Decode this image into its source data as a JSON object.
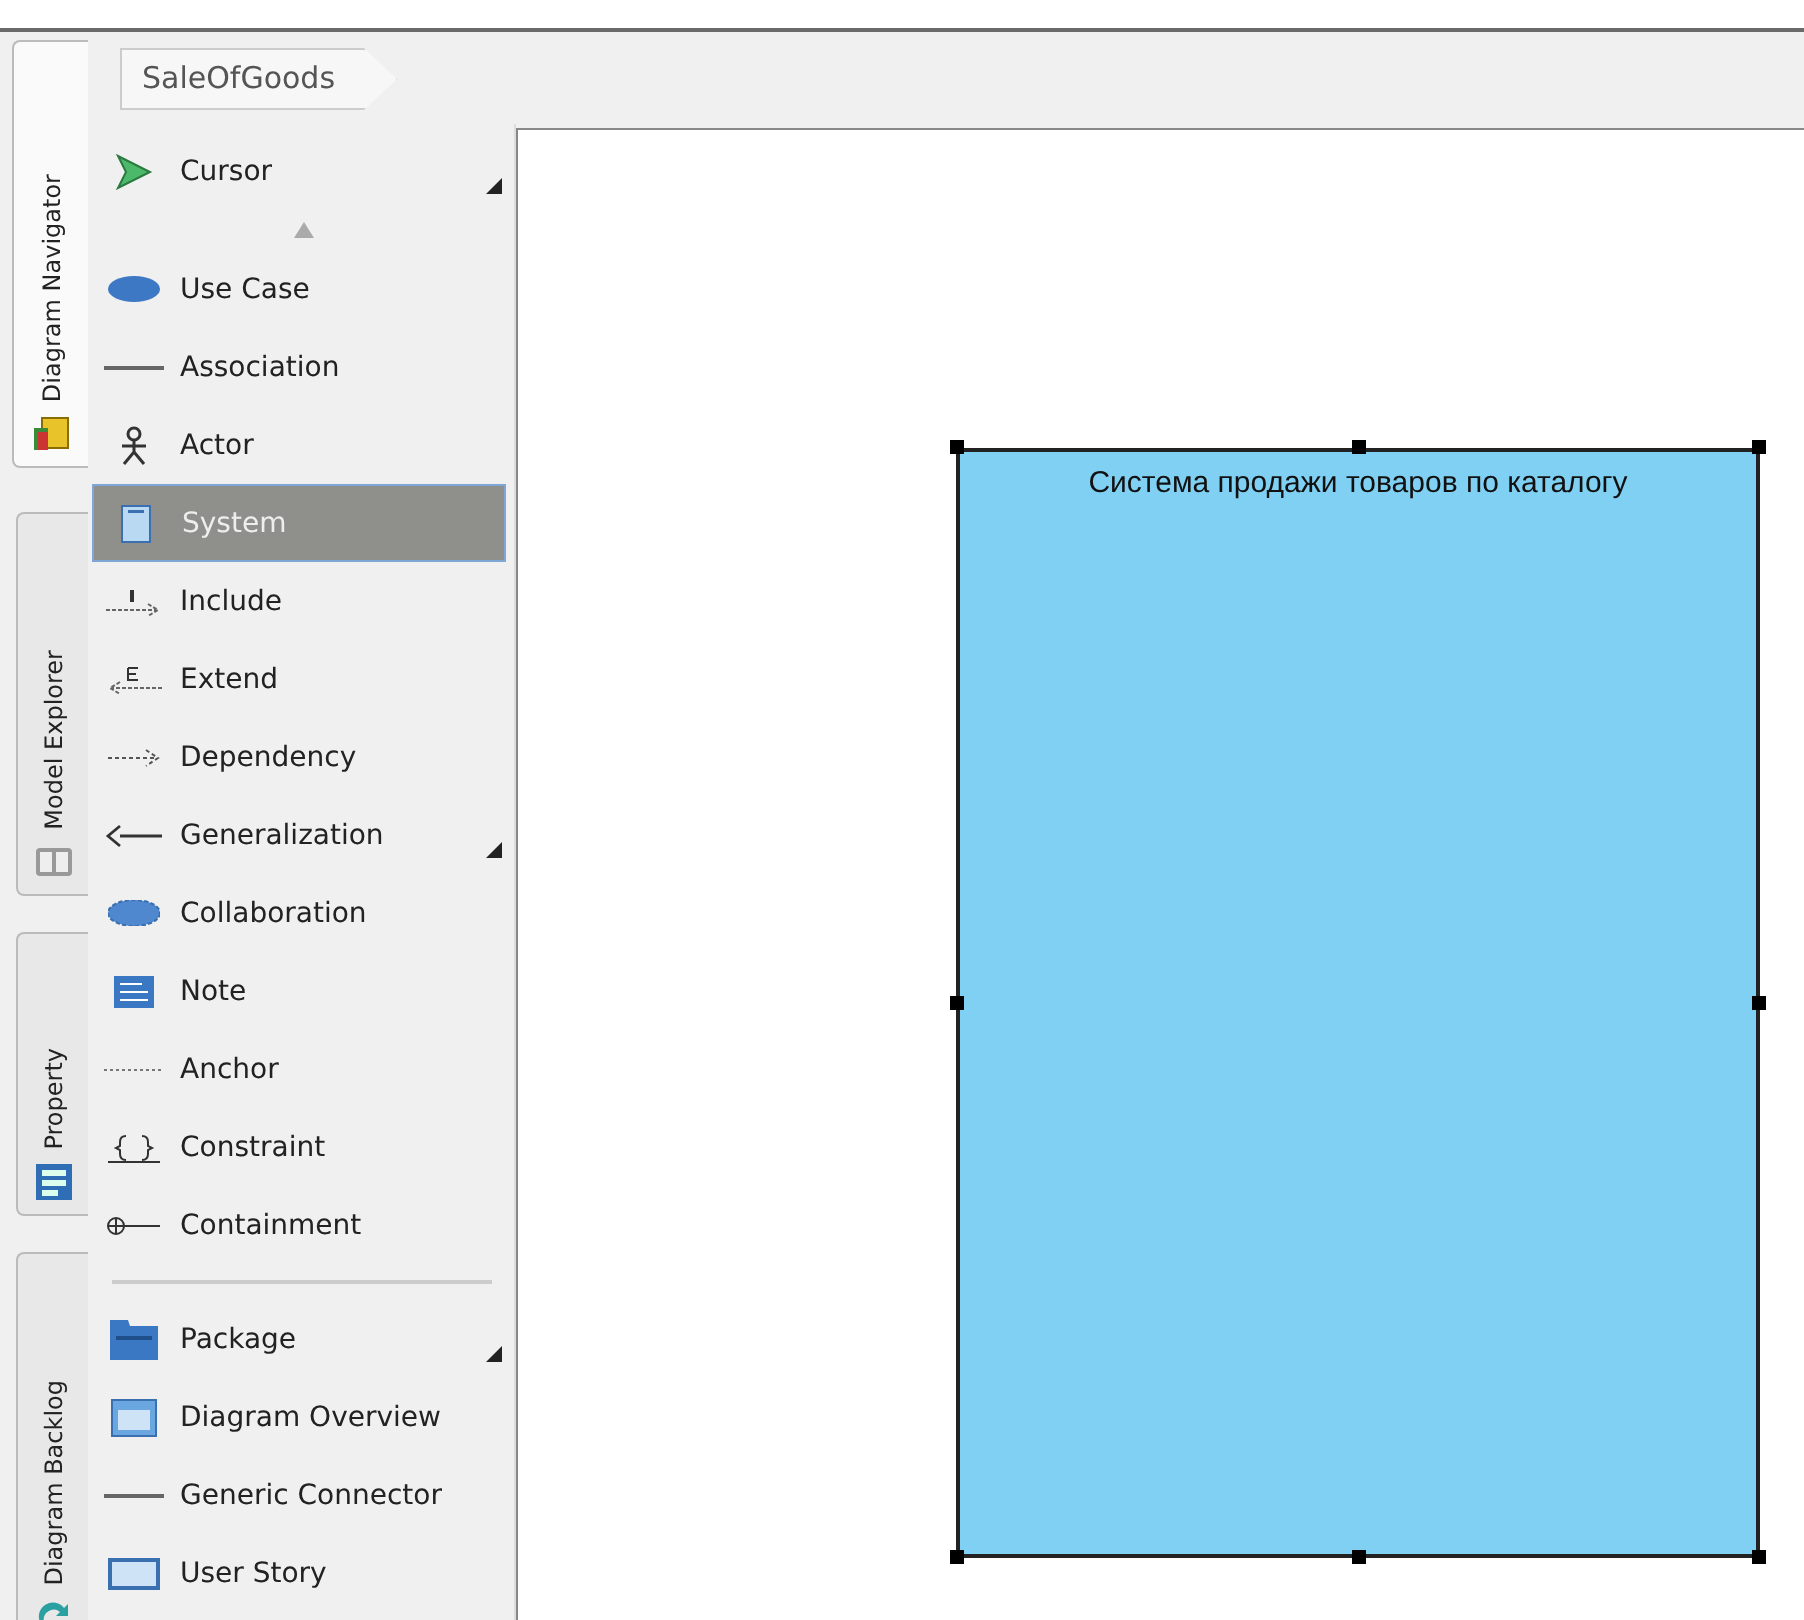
{
  "side_tabs": [
    {
      "label": "Diagram Navigator",
      "selected": true
    },
    {
      "label": "Model Explorer",
      "selected": false
    },
    {
      "label": "Property",
      "selected": false
    },
    {
      "label": "Diagram Backlog",
      "selected": false
    }
  ],
  "breadcrumb": "SaleOfGoods",
  "palette": [
    {
      "kind": "tool",
      "label": "Cursor",
      "selected": false,
      "more": true
    },
    {
      "kind": "scroll"
    },
    {
      "kind": "tool",
      "label": "Use Case",
      "selected": false,
      "more": false
    },
    {
      "kind": "tool",
      "label": "Association",
      "selected": false,
      "more": false
    },
    {
      "kind": "tool",
      "label": "Actor",
      "selected": false,
      "more": false
    },
    {
      "kind": "tool",
      "label": "System",
      "selected": true,
      "more": false
    },
    {
      "kind": "tool",
      "label": "Include",
      "selected": false,
      "more": false
    },
    {
      "kind": "tool",
      "label": "Extend",
      "selected": false,
      "more": false
    },
    {
      "kind": "tool",
      "label": "Dependency",
      "selected": false,
      "more": false
    },
    {
      "kind": "tool",
      "label": "Generalization",
      "selected": false,
      "more": true
    },
    {
      "kind": "tool",
      "label": "Collaboration",
      "selected": false,
      "more": false
    },
    {
      "kind": "tool",
      "label": "Note",
      "selected": false,
      "more": false
    },
    {
      "kind": "tool",
      "label": "Anchor",
      "selected": false,
      "more": false
    },
    {
      "kind": "tool",
      "label": "Constraint",
      "selected": false,
      "more": false
    },
    {
      "kind": "tool",
      "label": "Containment",
      "selected": false,
      "more": false
    },
    {
      "kind": "separator"
    },
    {
      "kind": "tool",
      "label": "Package",
      "selected": false,
      "more": true
    },
    {
      "kind": "tool",
      "label": "Diagram Overview",
      "selected": false,
      "more": false
    },
    {
      "kind": "tool",
      "label": "Generic Connector",
      "selected": false,
      "more": false
    },
    {
      "kind": "tool",
      "label": "User Story",
      "selected": false,
      "more": false
    }
  ],
  "canvas": {
    "system": {
      "name": "Система продажи товаров по каталогу",
      "selected": true
    }
  }
}
